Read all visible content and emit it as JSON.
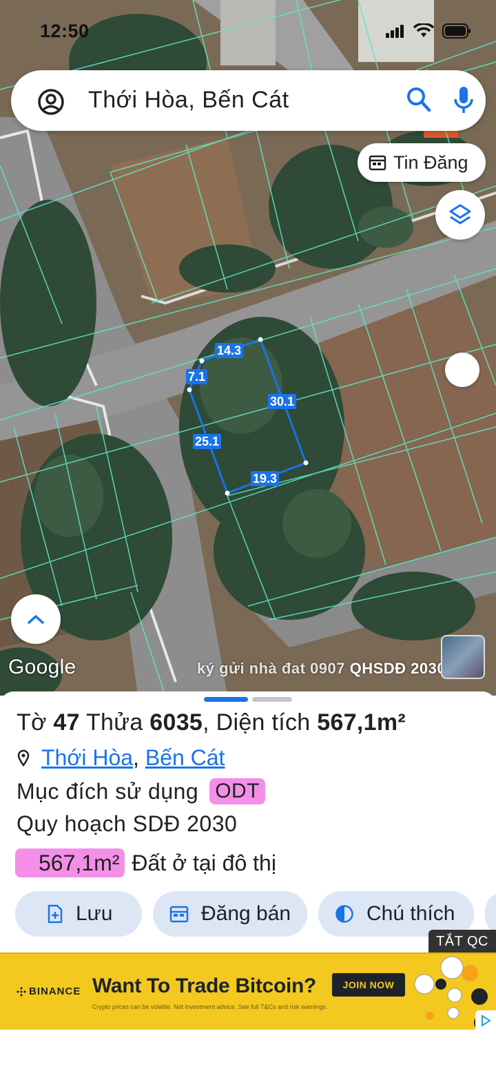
{
  "status_bar": {
    "time": "12:50"
  },
  "search": {
    "query": "Thới Hòa, Bến Cát"
  },
  "map": {
    "chip_label": "Tin Đăng",
    "google_label": "Google",
    "watermark_prefix": "ký gửi nhà đat 0907",
    "watermark_tail": "QHSDĐ 2030",
    "parcel_dimensions": [
      "14.3",
      "7.1",
      "30.1",
      "25.1",
      "19.3"
    ]
  },
  "sheet": {
    "to_label": "Tờ",
    "to_value": "47",
    "thua_label": "Thửa",
    "thua_value": "6035",
    "area_label": "Diện tích",
    "area_value": "567,1m²",
    "location_ward": "Thới Hòa",
    "location_sep": ",",
    "location_town": "Bến Cát",
    "purpose_label": "Mục đích sử dụng",
    "purpose_code": "ODT",
    "planning_label": "Quy hoạch SDĐ 2030",
    "zone_area": "567,1m²",
    "zone_type": "Đất ở tại đô thị",
    "actions": [
      "Lưu",
      "Đăng bán",
      "Chú thích"
    ],
    "hide_ads": "TẮT QC"
  },
  "ad": {
    "brand": "BINANCE",
    "headline": "Want To Trade Bitcoin?",
    "cta": "JOIN NOW",
    "fine_print": "Crypto prices can be volatile. Not investment advice. See full T&Cs and risk warnings."
  },
  "colors": {
    "accent": "#1a73e8",
    "badge_pink": "#f48fe8",
    "ad_yellow": "#f3c81f",
    "parcel_line": "#5ee6c8"
  }
}
